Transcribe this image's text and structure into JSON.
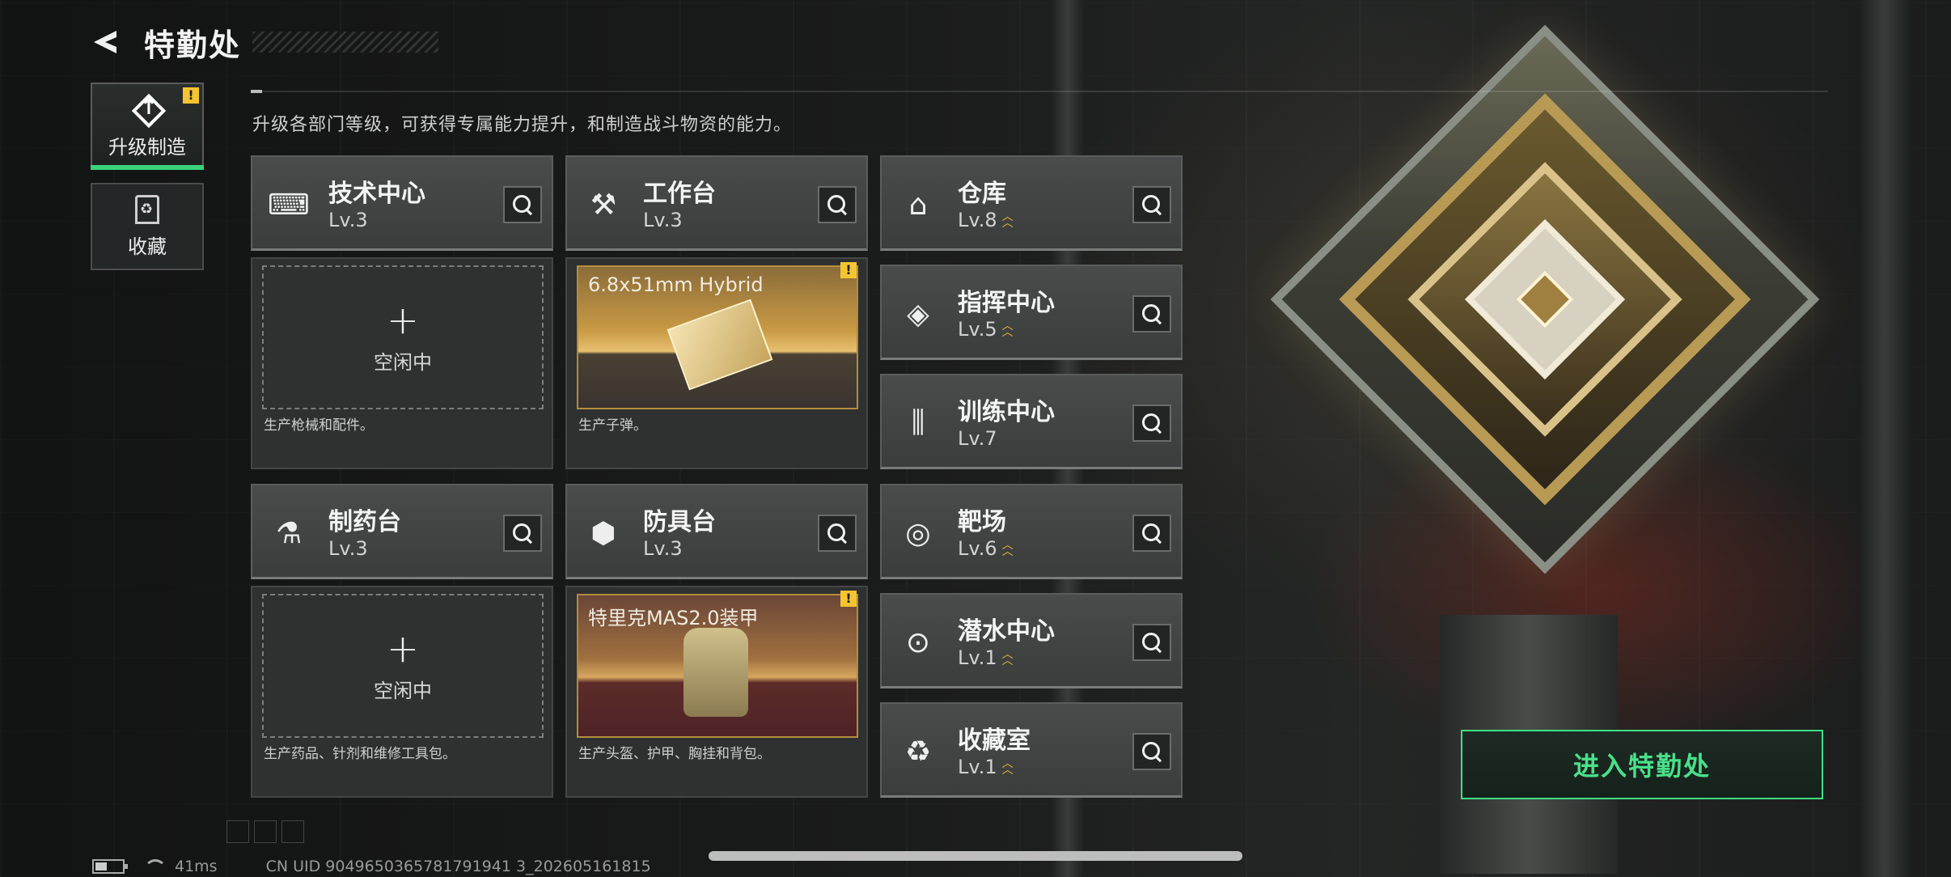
{
  "header": {
    "title": "特勤处"
  },
  "description": "升级各部门等级，可获得专属能力提升，和制造战斗物资的能力。",
  "side_tabs": [
    {
      "label": "升级制造",
      "icon": "upgrade-icon",
      "active": true,
      "alert": "!"
    },
    {
      "label": "收藏",
      "icon": "collection-icon",
      "active": false
    }
  ],
  "departments": [
    {
      "name": "技术中心",
      "level": "Lv.3",
      "icon": "tech-center-icon"
    },
    {
      "name": "工作台",
      "level": "Lv.3",
      "icon": "workbench-icon"
    },
    {
      "name": "制药台",
      "level": "Lv.3",
      "icon": "pharmacy-icon"
    },
    {
      "name": "防具台",
      "level": "Lv.3",
      "icon": "armor-bench-icon"
    },
    {
      "name": "仓库",
      "level": "Lv.8",
      "icon": "warehouse-icon",
      "upgradable": true
    },
    {
      "name": "指挥中心",
      "level": "Lv.5",
      "icon": "command-center-icon",
      "upgradable": true
    },
    {
      "name": "训练中心",
      "level": "Lv.7",
      "icon": "training-center-icon"
    },
    {
      "name": "靶场",
      "level": "Lv.6",
      "icon": "shooting-range-icon",
      "upgradable": true
    },
    {
      "name": "潜水中心",
      "level": "Lv.1",
      "icon": "diving-center-icon",
      "upgradable": true
    },
    {
      "name": "收藏室",
      "level": "Lv.1",
      "icon": "collection-room-icon",
      "upgradable": true
    }
  ],
  "slots": [
    {
      "state": "empty",
      "empty_text": "空闲中",
      "footer": "生产枪械和配件。"
    },
    {
      "state": "producing",
      "item_name": "6.8x51mm Hybrid",
      "footer": "生产子弹。",
      "alert": "!"
    },
    {
      "state": "empty",
      "empty_text": "空闲中",
      "footer": "生产药品、针剂和维修工具包。"
    },
    {
      "state": "producing",
      "item_name": "特里克MAS2.0装甲",
      "footer": "生产头盔、护甲、胸挂和背包。",
      "alert": "!"
    }
  ],
  "enter_button": {
    "label": "进入特勤处"
  },
  "status": {
    "ping": "41ms",
    "uid": "CN UID 9049650365781791941 3_202605161815"
  },
  "colors": {
    "accent_green": "#39d37a",
    "upgrade_gold": "#e8b93a",
    "alert_yellow": "#f5c531"
  }
}
